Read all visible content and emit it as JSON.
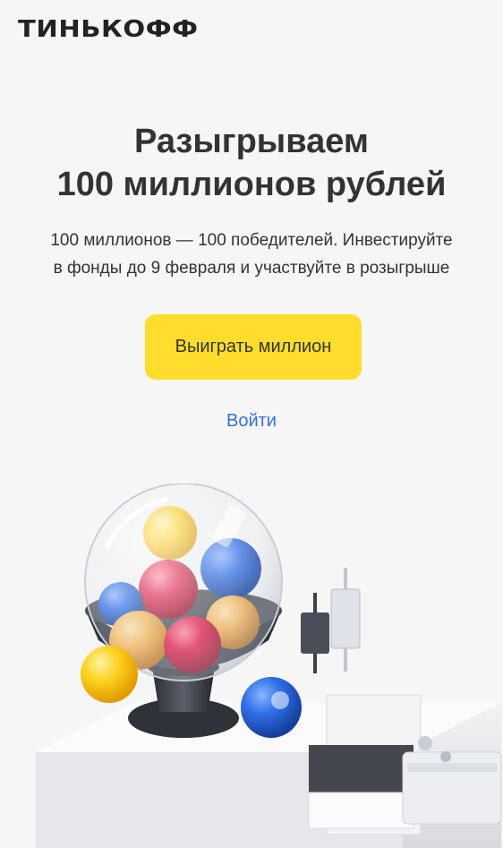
{
  "header": {
    "logo_text": "ТИНЬКОФФ"
  },
  "hero": {
    "title_line1": "Разыгрываем",
    "title_line2": "100 миллионов рублей",
    "subtitle_line1": "100 миллионов — 100 победителей. Инвестируйте",
    "subtitle_line2": "в фонды до 9 февраля и участвуйте в розыгрыше",
    "cta_label": "Выиграть миллион",
    "login_label": "Войти"
  },
  "colors": {
    "accent": "#ffdd2d",
    "link": "#336fee",
    "text": "#333333",
    "background": "#f6f6f6"
  },
  "illustration": {
    "icon": "lottery-drum-illustration"
  }
}
